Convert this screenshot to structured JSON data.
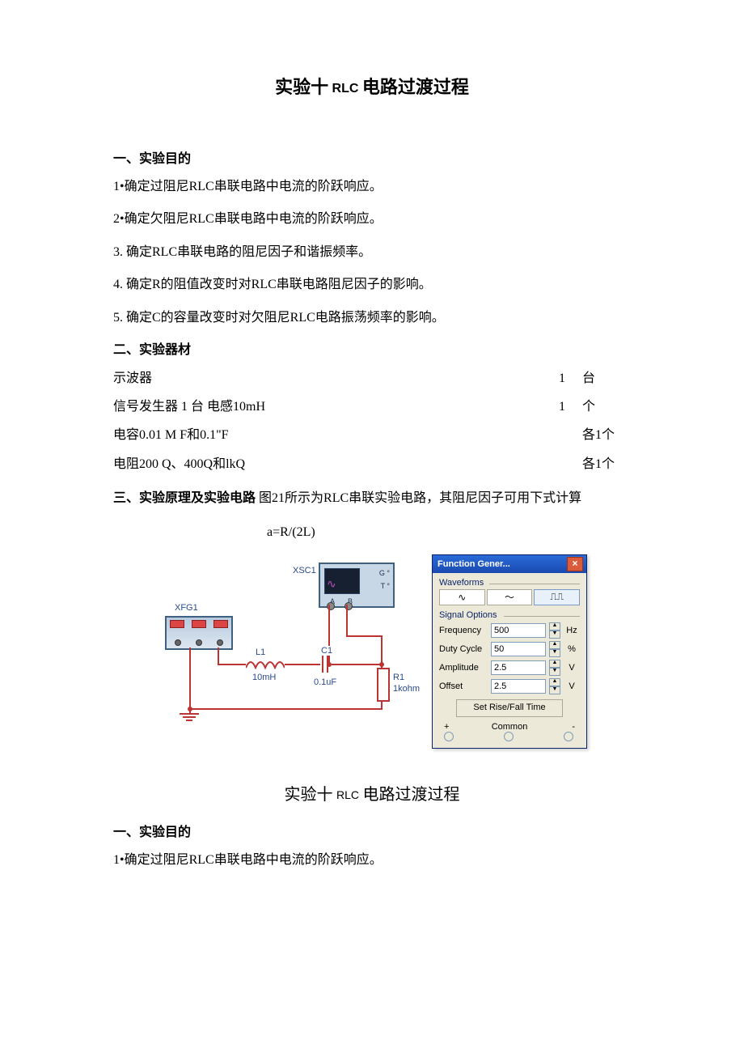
{
  "doc_title": {
    "big1": "实验十",
    "mid": "RLC",
    "big2": "电路过渡过程"
  },
  "sec1": "一、实验目的",
  "goals": [
    "1•确定过阻尼RLC串联电路中电流的阶跃响应。",
    "2•确定欠阻尼RLC串联电路中电流的阶跃响应。",
    "3.   确定RLC串联电路的阻尼因子和谐振频率。",
    "4.   确定R的阻值改变时对RLC串联电路阻尼因子的影响。",
    "5.   确定C的容量改变时对欠阻尼RLC电路振荡频率的影响。"
  ],
  "sec2": "二、实验器材",
  "equip": [
    {
      "name": "示波器",
      "c1": "1",
      "c2": "台"
    },
    {
      "name": "信号发生器  1 台  电感10mH",
      "c1": "1",
      "c2": "个"
    },
    {
      "name": "电容0.01 M F和0.1\"F",
      "c1": "",
      "c2": "各1个"
    },
    {
      "name": "电阻200 Q、400Q和lkQ",
      "c1": "",
      "c2": "各1个"
    }
  ],
  "sec3_lead": "三、实验原理及实验电路",
  "sec3_text": "图21所示为RLC串联实验电路，其阻尼因子可用下式计算",
  "formula": "a=R/(2L)",
  "schematic": {
    "xfg": "XFG1",
    "xsc": "XSC1",
    "scope_G": "G °",
    "scope_T": "T °",
    "scope_A": "A",
    "scope_B": "B",
    "L_name": "L1",
    "L_val": "10mH",
    "C_name": "C1",
    "C_val": "0.1uF",
    "R_name": "R1",
    "R_val": "1kohm"
  },
  "fg": {
    "title": "Function Gener...",
    "waveforms_lbl": "Waveforms",
    "signal_lbl": "Signal Options",
    "rows": {
      "freq_lbl": "Frequency",
      "freq_val": "500",
      "freq_unit": "Hz",
      "duty_lbl": "Duty Cycle",
      "duty_val": "50",
      "duty_unit": "%",
      "amp_lbl": "Amplitude",
      "amp_val": "2.5",
      "amp_unit": "V",
      "off_lbl": "Offset",
      "off_val": "2.5",
      "off_unit": "V"
    },
    "rise_btn": "Set Rise/Fall Time",
    "foot_plus": "+",
    "foot_common": "Common",
    "foot_minus": "-"
  },
  "repeat_goal1": "1•确定过阻尼RLC串联电路中电流的阶跃响应。"
}
